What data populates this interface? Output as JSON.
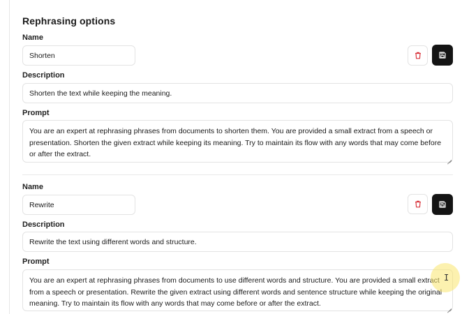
{
  "section": {
    "title": "Rephrasing options"
  },
  "options": [
    {
      "name_label": "Name",
      "name_value": "Shorten",
      "description_label": "Description",
      "description_value": "Shorten the text while keeping the meaning.",
      "prompt_label": "Prompt",
      "prompt_value": "You are an expert at rephrasing phrases from documents to shorten them. You are provided a small extract from a speech or presentation. Shorten the given extract while keeping its meaning. Try to maintain its flow with any words that may come before or after the extract."
    },
    {
      "name_label": "Name",
      "name_value": "Rewrite",
      "description_label": "Description",
      "description_value": "Rewrite the text using different words and structure.",
      "prompt_label": "Prompt",
      "prompt_value": "You are an expert at rephrasing phrases from documents to use different words and structure. You are provided a small extract from a speech or presentation. Rewrite the given extract using different words and sentence structure while keeping the original meaning. Try to maintain its flow with any words that may come before or after the extract."
    }
  ],
  "icons": {
    "delete": "trash-icon",
    "save": "floppy-disk-icon",
    "cursor": "text-cursor-icon"
  },
  "colors": {
    "delete_icon": "#d9363e",
    "save_bg": "#141414",
    "cursor_highlight": "#f7e36b"
  }
}
